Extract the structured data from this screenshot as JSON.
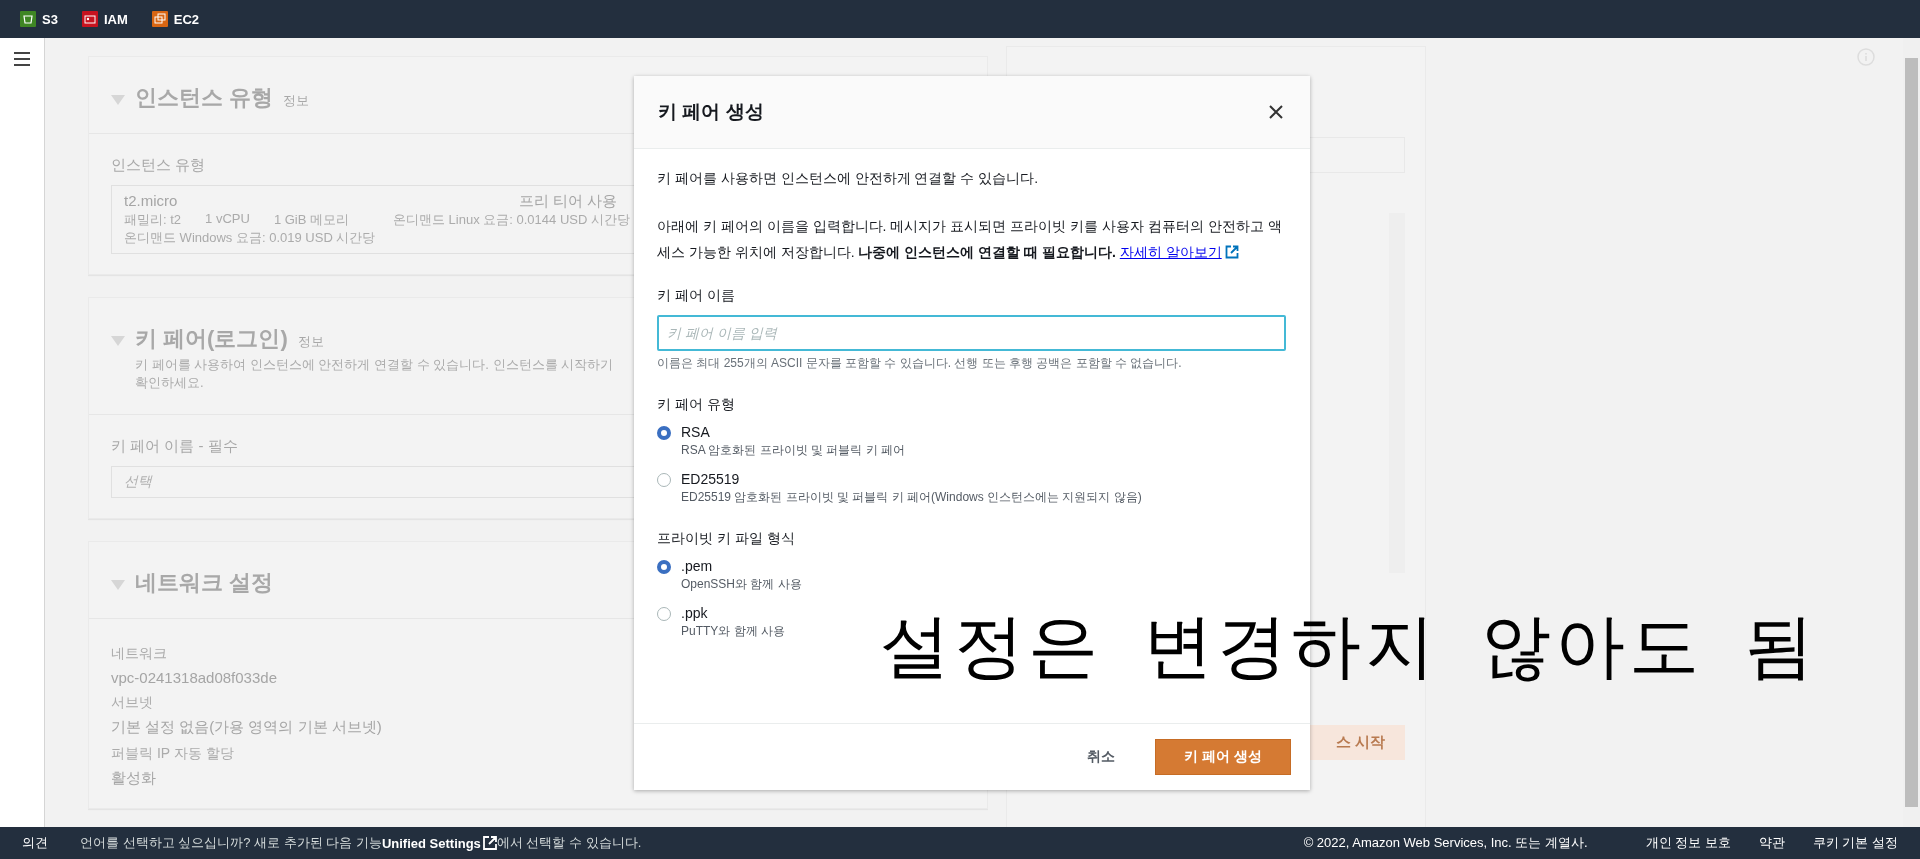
{
  "top_bar": {
    "services": [
      {
        "kind": "storage",
        "label": "S3"
      },
      {
        "kind": "identity",
        "label": "IAM"
      },
      {
        "kind": "compute",
        "label": "EC2"
      }
    ]
  },
  "background": {
    "sections": [
      {
        "kind": "instance_type",
        "title": "인스턴스 유형",
        "info": "정보",
        "field_label": "인스턴스 유형",
        "type_name": "t2.micro",
        "tier": "프리 티어 사용",
        "specs": [
          "패밀리: t2",
          "1 vCPU",
          "1 GiB 메모리",
          "온디맨드 Linux 요금: 0.0144 USD 시간당"
        ],
        "windows_price": "온디맨드 Windows 요금: 0.019 USD 시간당"
      },
      {
        "kind": "key_pair",
        "title": "키 페어(로그인)",
        "info": "정보",
        "description": "키 페어를 사용하여 인스턴스에 안전하게 연결할 수 있습니다. 인스턴스를 시작하기",
        "description_2": "확인하세요.",
        "field_label": "키 페어 이름 - 필수",
        "select_placeholder": "선택"
      },
      {
        "kind": "network",
        "title": "네트워크 설정",
        "fields": [
          {
            "label": "네트워크",
            "value": "vpc-0241318ad08f033de"
          },
          {
            "label": "서브넷",
            "value": "기본 설정 없음(가용 영역의 기본 서브넷)"
          },
          {
            "label": "퍼블릭 IP 자동 할당",
            "value": "활성화"
          }
        ]
      }
    ],
    "summary": {
      "launch_button": "스 시작"
    }
  },
  "modal": {
    "title": "키 페어 생성",
    "intro": "키 페어를 사용하면 인스턴스에 안전하게 연결할 수 있습니다.",
    "description": "아래에 키 페어의 이름을 입력합니다. 메시지가 표시되면 프라이빗 키를 사용자 컴퓨터의 안전하고 액세스 가능한 위치에 저장합니다. **나중에 인스턴스에 연결할 때 필요합니다.**",
    "learn_more": "자세히 알아보기",
    "name_field": {
      "label": "키 페어 이름",
      "placeholder": "키 페어 이름 입력",
      "hint": "이름은 최대 255개의 ASCII 문자를 포함할 수 있습니다. 선행 또는 후행 공백은 포함할 수 없습니다."
    },
    "groups": [
      {
        "label": "키 페어 유형",
        "options": [
          {
            "label": "RSA",
            "description": "RSA 암호화된 프라이빗 및 퍼블릭 키 페어",
            "selected": true
          },
          {
            "label": "ED25519",
            "description": "ED25519 암호화된 프라이빗 및 퍼블릭 키 페어(Windows 인스턴스에는 지원되지 않음)",
            "selected": false
          }
        ]
      },
      {
        "label": "프라이빗 키 파일 형식",
        "options": [
          {
            "label": ".pem",
            "description": "OpenSSH와 함께 사용",
            "selected": true
          },
          {
            "label": ".ppk",
            "description": "PuTTY와 함께 사용",
            "selected": false
          }
        ]
      }
    ],
    "cancel": "취소",
    "create": "키 페어 생성"
  },
  "annotation": "설정은 변경하지 않아도 됨",
  "footer": {
    "feedback": "의견",
    "message": "언어를 선택하고 싶으십니까? 새로 추가된 다음 기능",
    "settings_link": "Unified Settings",
    "message_end": "에서 선택할 수 있습니다.",
    "copyright": "© 2022, Amazon Web Services, Inc. 또는 계열사.",
    "links": [
      "개인 정보 보호",
      "약관",
      "쿠키 기본 설정"
    ]
  }
}
